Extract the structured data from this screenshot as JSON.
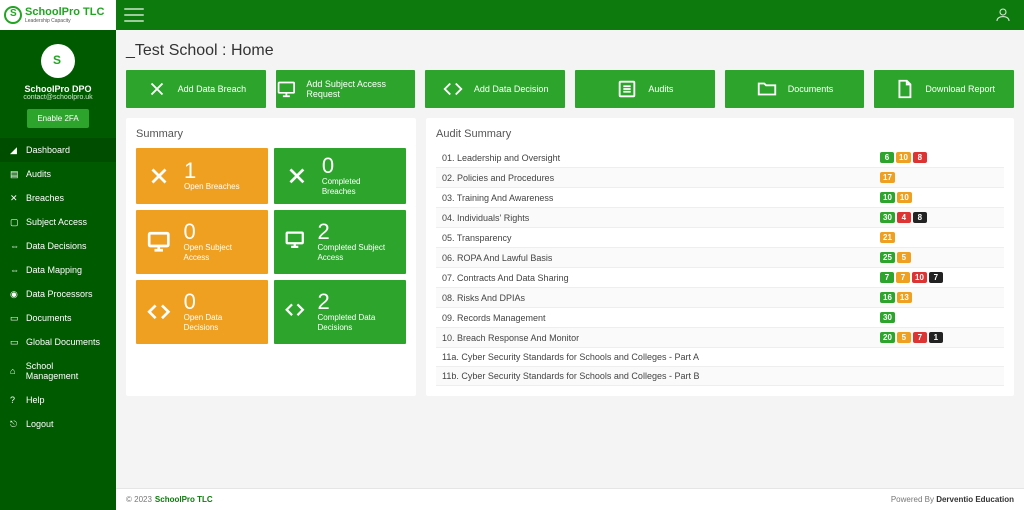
{
  "app": {
    "name": "SchoolPro TLC",
    "tagline": "Leadership Capacity"
  },
  "user": {
    "name": "SchoolPro DPO",
    "email": "contact@schoolpro.uk",
    "enable_2fa": "Enable 2FA"
  },
  "nav": {
    "dashboard": "Dashboard",
    "audits": "Audits",
    "breaches": "Breaches",
    "subject_access": "Subject Access",
    "data_decisions": "Data Decisions",
    "data_mapping": "Data Mapping",
    "data_processors": "Data Processors",
    "documents": "Documents",
    "global_documents": "Global Documents",
    "school_management": "School Management",
    "help": "Help",
    "logout": "Logout"
  },
  "page": {
    "title": "_Test School : Home"
  },
  "actions": {
    "add_breach": "Add Data Breach",
    "add_sar": "Add Subject Access Request",
    "add_decision": "Add Data Decision",
    "audits": "Audits",
    "documents": "Documents",
    "download_report": "Download Report"
  },
  "summary": {
    "title": "Summary",
    "open_breaches": {
      "count": "1",
      "label": "Open Breaches"
    },
    "completed_breaches": {
      "count": "0",
      "label": "Completed Breaches"
    },
    "open_sar": {
      "count": "0",
      "label": "Open Subject Access"
    },
    "completed_sar": {
      "count": "2",
      "label": "Completed Subject Access"
    },
    "open_decisions": {
      "count": "0",
      "label": "Open Data Decisions"
    },
    "completed_decisions": {
      "count": "2",
      "label": "Completed Data Decisions"
    }
  },
  "audit": {
    "title": "Audit Summary",
    "rows": [
      {
        "label": "01. Leadership and Oversight",
        "badges": [
          {
            "v": "6",
            "c": "green"
          },
          {
            "v": "10",
            "c": "orange"
          },
          {
            "v": "8",
            "c": "red"
          }
        ]
      },
      {
        "label": "02. Policies and Procedures",
        "badges": [
          {
            "v": "17",
            "c": "orange"
          }
        ]
      },
      {
        "label": "03. Training And Awareness",
        "badges": [
          {
            "v": "10",
            "c": "green"
          },
          {
            "v": "10",
            "c": "orange"
          }
        ]
      },
      {
        "label": "04. Individuals' Rights",
        "badges": [
          {
            "v": "30",
            "c": "green"
          },
          {
            "v": "4",
            "c": "red"
          },
          {
            "v": "8",
            "c": "black"
          }
        ]
      },
      {
        "label": "05. Transparency",
        "badges": [
          {
            "v": "21",
            "c": "orange"
          }
        ]
      },
      {
        "label": "06. ROPA And Lawful Basis",
        "badges": [
          {
            "v": "25",
            "c": "green"
          },
          {
            "v": "5",
            "c": "orange"
          }
        ]
      },
      {
        "label": "07. Contracts And Data Sharing",
        "badges": [
          {
            "v": "7",
            "c": "green"
          },
          {
            "v": "7",
            "c": "orange"
          },
          {
            "v": "10",
            "c": "red"
          },
          {
            "v": "7",
            "c": "black"
          }
        ]
      },
      {
        "label": "08. Risks And DPIAs",
        "badges": [
          {
            "v": "16",
            "c": "green"
          },
          {
            "v": "13",
            "c": "orange"
          }
        ]
      },
      {
        "label": "09. Records Management",
        "badges": [
          {
            "v": "30",
            "c": "green"
          }
        ]
      },
      {
        "label": "10. Breach Response And Monitor",
        "badges": [
          {
            "v": "20",
            "c": "green"
          },
          {
            "v": "5",
            "c": "orange"
          },
          {
            "v": "7",
            "c": "red"
          },
          {
            "v": "1",
            "c": "black"
          }
        ]
      },
      {
        "label": "11a. Cyber Security Standards for Schools and Colleges - Part A",
        "badges": []
      },
      {
        "label": "11b. Cyber Security Standards for Schools and Colleges - Part B",
        "badges": []
      }
    ]
  },
  "footer": {
    "copyright": "© 2023",
    "brand": "SchoolPro TLC",
    "powered_prefix": "Powered By",
    "powered_brand": "Derventio Education"
  }
}
